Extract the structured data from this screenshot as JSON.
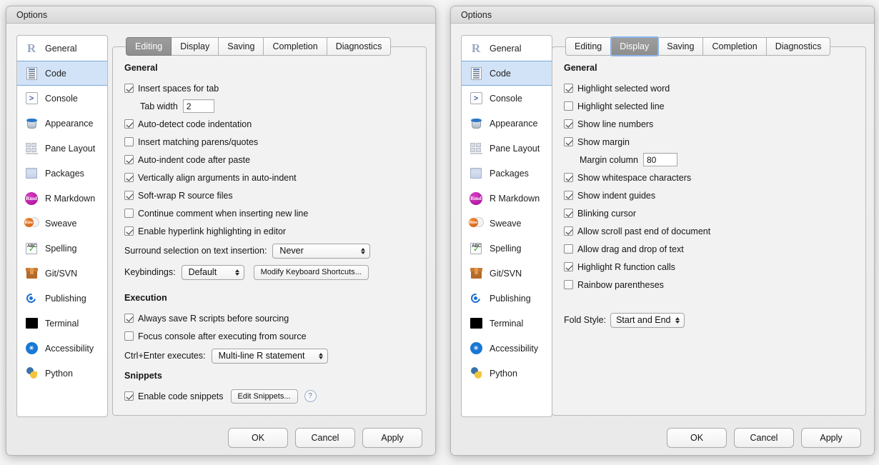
{
  "windows": [
    {
      "title": "Options",
      "sidebar": {
        "items": [
          {
            "label": "General",
            "icon": "r-logo-icon",
            "selected": false
          },
          {
            "label": "Code",
            "icon": "code-document-icon",
            "selected": true
          },
          {
            "label": "Console",
            "icon": "console-prompt-icon",
            "selected": false
          },
          {
            "label": "Appearance",
            "icon": "paint-bucket-icon",
            "selected": false
          },
          {
            "label": "Pane Layout",
            "icon": "pane-layout-icon",
            "selected": false
          },
          {
            "label": "Packages",
            "icon": "package-box-icon",
            "selected": false
          },
          {
            "label": "R Markdown",
            "icon": "rmd-badge-icon",
            "selected": false
          },
          {
            "label": "Sweave",
            "icon": "sweave-pdf-icon",
            "selected": false
          },
          {
            "label": "Spelling",
            "icon": "abc-check-icon",
            "selected": false
          },
          {
            "label": "Git/SVN",
            "icon": "cardboard-box-icon",
            "selected": false
          },
          {
            "label": "Publishing",
            "icon": "publish-orbit-icon",
            "selected": false
          },
          {
            "label": "Terminal",
            "icon": "terminal-black-icon",
            "selected": false
          },
          {
            "label": "Accessibility",
            "icon": "accessibility-icon",
            "selected": false
          },
          {
            "label": "Python",
            "icon": "python-logo-icon",
            "selected": false
          }
        ]
      },
      "tabs": [
        {
          "label": "Editing",
          "active": true,
          "focused": false
        },
        {
          "label": "Display",
          "active": false,
          "focused": false
        },
        {
          "label": "Saving",
          "active": false,
          "focused": false
        },
        {
          "label": "Completion",
          "active": false,
          "focused": false
        },
        {
          "label": "Diagnostics",
          "active": false,
          "focused": false
        }
      ],
      "sections": {
        "general_heading": "General",
        "execution_heading": "Execution",
        "snippets_heading": "Snippets",
        "cb_insert_spaces": "Insert spaces for tab",
        "tab_width_label": "Tab width",
        "tab_width_value": "2",
        "cb_auto_detect": "Auto-detect code indentation",
        "cb_matching_parens": "Insert matching parens/quotes",
        "cb_auto_indent_paste": "Auto-indent code after paste",
        "cb_vertical_align": "Vertically align arguments in auto-indent",
        "cb_soft_wrap": "Soft-wrap R source files",
        "cb_continue_comment": "Continue comment when inserting new line",
        "cb_hyperlink": "Enable hyperlink highlighting in editor",
        "surround_label": "Surround selection on text insertion:",
        "surround_value": "Never",
        "keybindings_label": "Keybindings:",
        "keybindings_value": "Default",
        "modify_shortcuts_button": "Modify Keyboard Shortcuts...",
        "cb_always_save": "Always save R scripts before sourcing",
        "cb_focus_console": "Focus console after executing from source",
        "ctrl_enter_label": "Ctrl+Enter executes:",
        "ctrl_enter_value": "Multi-line R statement",
        "cb_enable_snippets": "Enable code snippets",
        "edit_snippets_button": "Edit Snippets...",
        "help_icon_label": "?"
      },
      "footer": {
        "ok": "OK",
        "cancel": "Cancel",
        "apply": "Apply"
      }
    },
    {
      "title": "Options",
      "sidebar": {
        "items": [
          {
            "label": "General",
            "icon": "r-logo-icon",
            "selected": false
          },
          {
            "label": "Code",
            "icon": "code-document-icon",
            "selected": true
          },
          {
            "label": "Console",
            "icon": "console-prompt-icon",
            "selected": false
          },
          {
            "label": "Appearance",
            "icon": "paint-bucket-icon",
            "selected": false
          },
          {
            "label": "Pane Layout",
            "icon": "pane-layout-icon",
            "selected": false
          },
          {
            "label": "Packages",
            "icon": "package-box-icon",
            "selected": false
          },
          {
            "label": "R Markdown",
            "icon": "rmd-badge-icon",
            "selected": false
          },
          {
            "label": "Sweave",
            "icon": "sweave-pdf-icon",
            "selected": false
          },
          {
            "label": "Spelling",
            "icon": "abc-check-icon",
            "selected": false
          },
          {
            "label": "Git/SVN",
            "icon": "cardboard-box-icon",
            "selected": false
          },
          {
            "label": "Publishing",
            "icon": "publish-orbit-icon",
            "selected": false
          },
          {
            "label": "Terminal",
            "icon": "terminal-black-icon",
            "selected": false
          },
          {
            "label": "Accessibility",
            "icon": "accessibility-icon",
            "selected": false
          },
          {
            "label": "Python",
            "icon": "python-logo-icon",
            "selected": false
          }
        ]
      },
      "tabs": [
        {
          "label": "Editing",
          "active": false,
          "focused": false
        },
        {
          "label": "Display",
          "active": true,
          "focused": true
        },
        {
          "label": "Saving",
          "active": false,
          "focused": false
        },
        {
          "label": "Completion",
          "active": false,
          "focused": false
        },
        {
          "label": "Diagnostics",
          "active": false,
          "focused": false
        }
      ],
      "sections": {
        "general_heading": "General",
        "cb_highlight_word": "Highlight selected word",
        "cb_highlight_line": "Highlight selected line",
        "cb_line_numbers": "Show line numbers",
        "cb_show_margin": "Show margin",
        "margin_column_label": "Margin column",
        "margin_column_value": "80",
        "cb_whitespace": "Show whitespace characters",
        "cb_indent_guides": "Show indent guides",
        "cb_blinking_cursor": "Blinking cursor",
        "cb_scroll_past_end": "Allow scroll past end of document",
        "cb_drag_drop": "Allow drag and drop of text",
        "cb_highlight_fn": "Highlight R function calls",
        "cb_rainbow_parens": "Rainbow parentheses",
        "fold_style_label": "Fold Style:",
        "fold_style_value": "Start and End"
      },
      "footer": {
        "ok": "OK",
        "cancel": "Cancel",
        "apply": "Apply"
      }
    }
  ],
  "colors": {
    "selection_blue": "#d3e3f7",
    "selection_border": "#7aa8d8",
    "active_tab_gray": "#959595",
    "focus_ring": "#8ab4e8",
    "window_bg": "#ececec",
    "panel_bg": "#f2f2f2"
  }
}
